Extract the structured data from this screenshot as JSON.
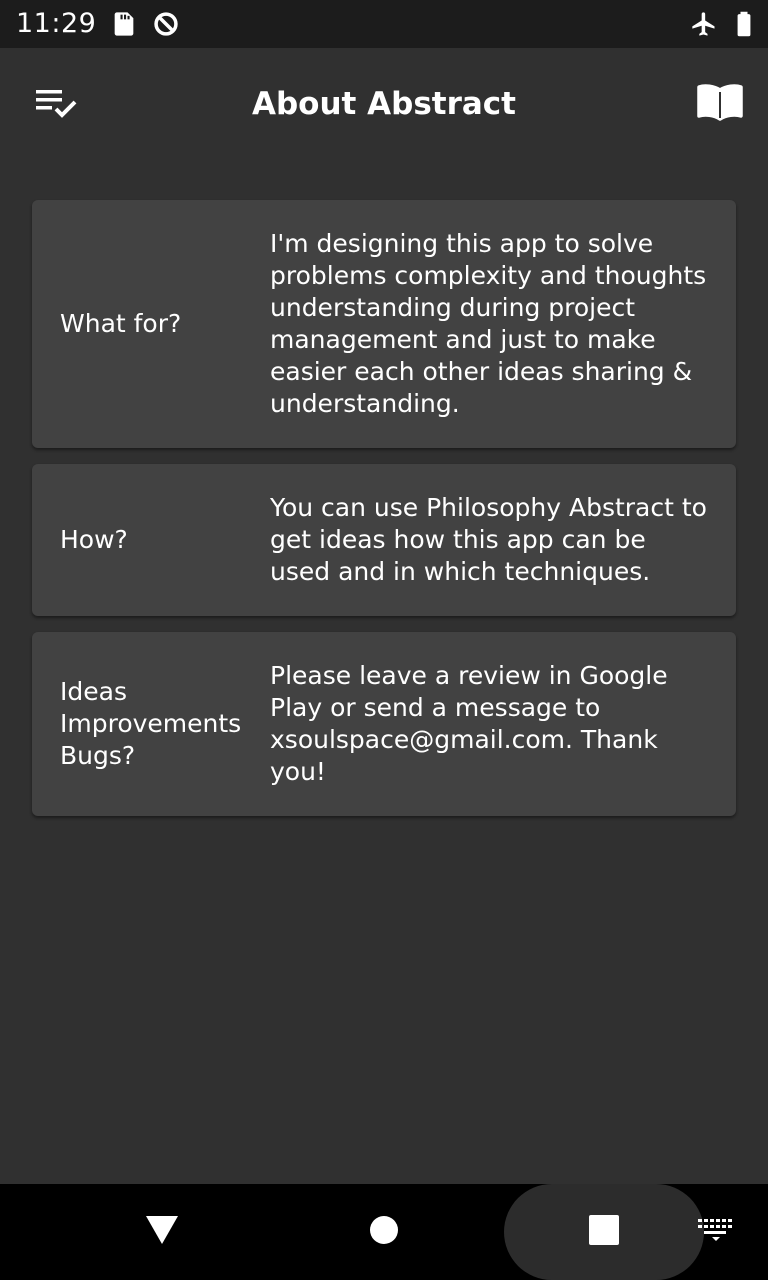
{
  "status_bar": {
    "time": "11:29",
    "icons": [
      "sd-card-icon",
      "sync-disabled-icon",
      "airplane-mode-icon",
      "battery-icon"
    ]
  },
  "app_bar": {
    "title": "About Abstract",
    "left_icon": "playlist-check-icon",
    "right_icon": "book-open-icon"
  },
  "cards": [
    {
      "label": "What for?",
      "text": "I'm designing this app to solve problems complexity and thoughts understanding during project management and just to make easier each other ideas sharing & understanding."
    },
    {
      "label": "How?",
      "text": "You can use Philosophy Abstract to get ideas how this app can be used and in which techniques."
    },
    {
      "label": "Ideas Improvements Bugs?",
      "text": "Please leave a review in Google Play or send a message to xsoulspace@gmail.com. Thank you!"
    }
  ],
  "nav_bar": {
    "icons": [
      "back-icon",
      "home-icon",
      "recents-icon",
      "keyboard-icon"
    ]
  },
  "colors": {
    "background": "#303030",
    "card": "#424242",
    "status_bar": "#1c1c1c",
    "nav_bar": "#000000",
    "text": "#ffffff"
  }
}
